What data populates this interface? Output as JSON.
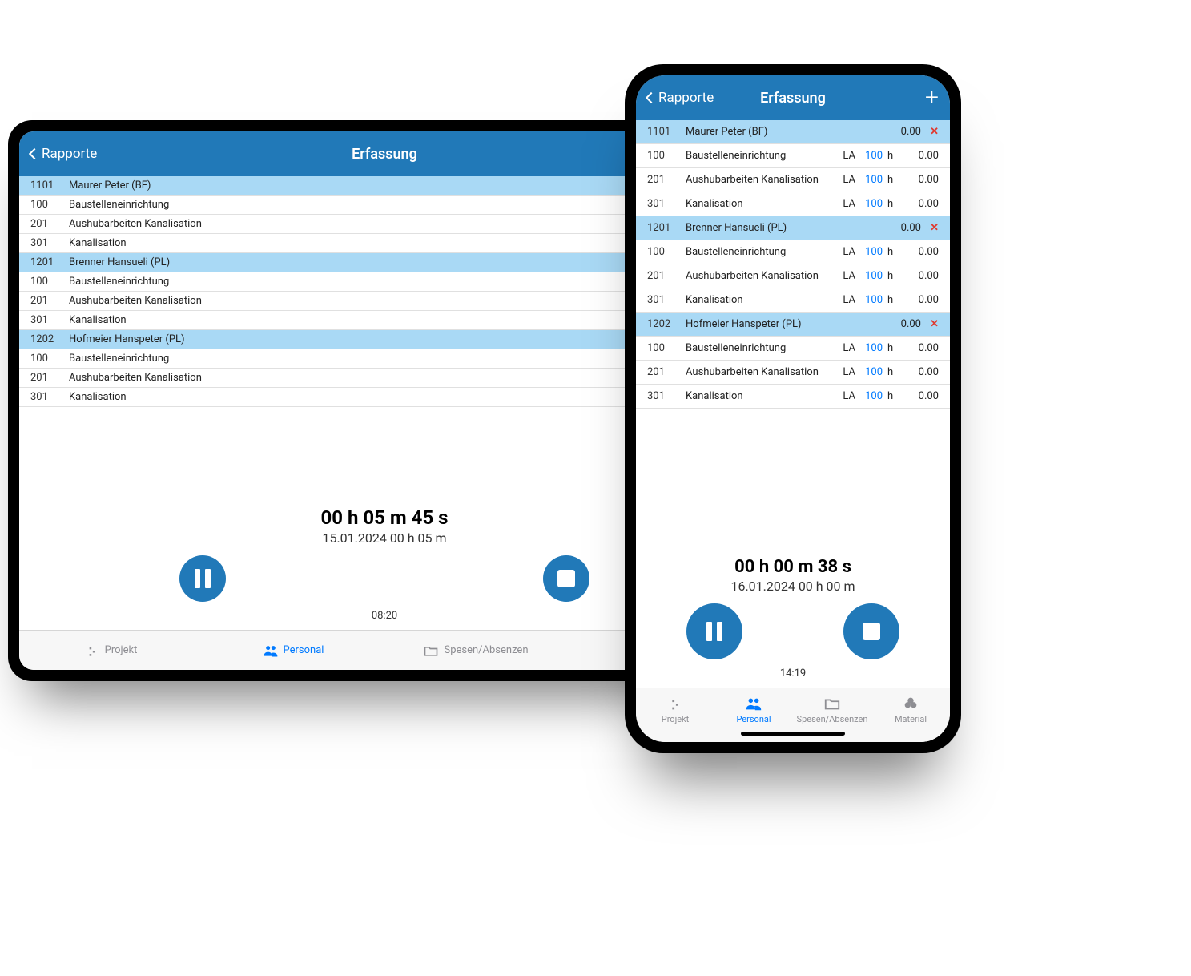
{
  "nav": {
    "back": "Rapporte",
    "title": "Erfassung",
    "plus": "+"
  },
  "units": {
    "la": "LA",
    "la_value": "100",
    "h": "h",
    "zero": "0.00"
  },
  "people": [
    {
      "code": "1101",
      "name": "Maurer Peter (BF)"
    },
    {
      "code": "1201",
      "name": "Brenner Hansueli (PL)"
    },
    {
      "code": "1202",
      "name": "Hofmeier Hanspeter (PL)"
    }
  ],
  "tasks": [
    {
      "code": "100",
      "name": "Baustelleneinrichtung"
    },
    {
      "code": "201",
      "name": "Aushubarbeiten Kanalisation"
    },
    {
      "code": "301",
      "name": "Kanalisation"
    }
  ],
  "tablet_timer": {
    "big": "00 h 05 m 45 s",
    "sub": "15.01.2024 00 h 05 m",
    "small": "08:20"
  },
  "phone_timer": {
    "big": "00 h 00 m 38 s",
    "sub": "16.01.2024 00 h 00 m",
    "small": "14:19"
  },
  "tabs": {
    "projekt": "Projekt",
    "personal": "Personal",
    "spesen": "Spesen/Absenzen",
    "material": "Material"
  }
}
